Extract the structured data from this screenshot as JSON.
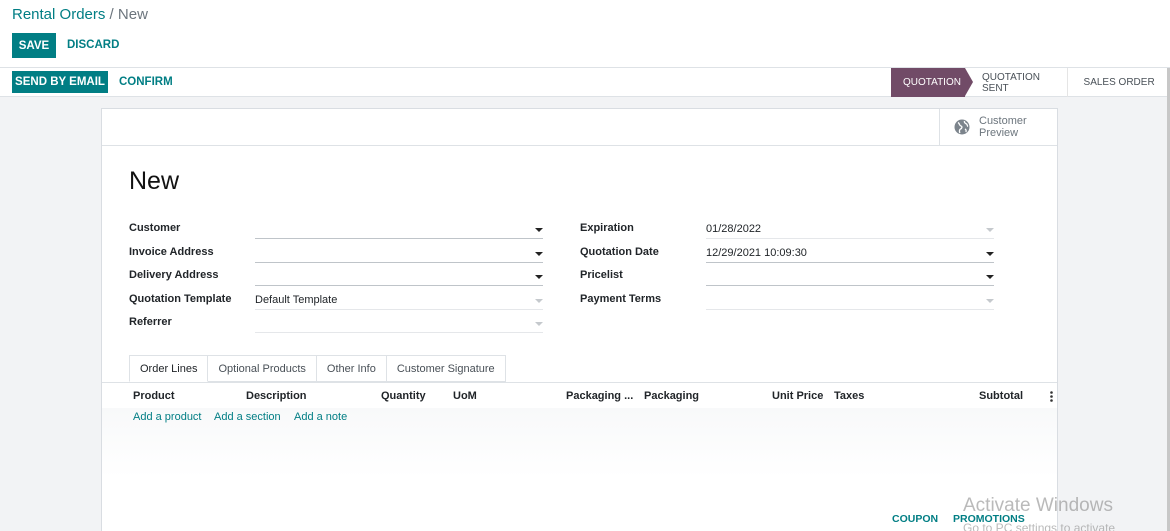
{
  "breadcrumb": {
    "parent": "Rental Orders",
    "separator": " / ",
    "current": "New"
  },
  "toolbar": {
    "save_label": "SAVE",
    "discard_label": "DISCARD"
  },
  "actions": {
    "send_email_label": "SEND BY EMAIL",
    "confirm_label": "CONFIRM"
  },
  "stages": [
    "QUOTATION",
    "QUOTATION SENT",
    "SALES ORDER"
  ],
  "active_stage": "QUOTATION",
  "preview": {
    "label": "Customer Preview",
    "icon": "globe-icon"
  },
  "form": {
    "title": "New",
    "left_fields": [
      {
        "label": "Customer",
        "value": ""
      },
      {
        "label": "Invoice Address",
        "value": ""
      },
      {
        "label": "Delivery Address",
        "value": ""
      },
      {
        "label": "Quotation Template",
        "value": "Default Template"
      },
      {
        "label": "Referrer",
        "value": ""
      }
    ],
    "right_fields": [
      {
        "label": "Expiration",
        "value": "01/28/2022"
      },
      {
        "label": "Quotation Date",
        "value": "12/29/2021 10:09:30"
      },
      {
        "label": "Pricelist",
        "value": ""
      },
      {
        "label": "Payment Terms",
        "value": ""
      }
    ]
  },
  "tabs": [
    "Order Lines",
    "Optional Products",
    "Other Info",
    "Customer Signature"
  ],
  "lines": {
    "columns": [
      "Product",
      "Description",
      "Quantity",
      "UoM",
      "Packaging ...",
      "Packaging",
      "Unit Price",
      "Taxes",
      "Subtotal"
    ],
    "add_links": [
      "Add a product",
      "Add a section",
      "Add a note"
    ]
  },
  "bottom_buttons": {
    "coupon": "COUPON",
    "promotions": "PROMOTIONS"
  },
  "watermark": {
    "title": "Activate Windows",
    "subtitle": "Go to PC settings to activate Windows."
  },
  "colors": {
    "primary": "#017e84",
    "stage_active": "#714b67"
  }
}
